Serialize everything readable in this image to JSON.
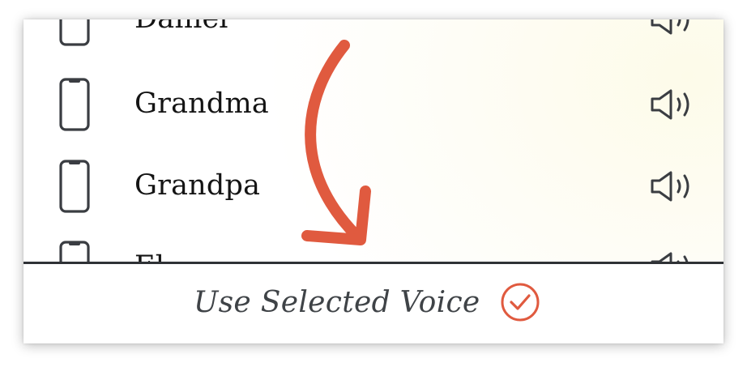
{
  "voices": [
    {
      "name": "Daniel"
    },
    {
      "name": "Grandma"
    },
    {
      "name": "Grandpa"
    },
    {
      "name": "El..."
    }
  ],
  "footer": {
    "use_voice_label": "Use Selected Voice"
  },
  "icons": {
    "device": "phone-icon",
    "play": "speaker-icon",
    "confirm": "check-circle-icon",
    "overlay": "curved-arrow-icon"
  },
  "colors": {
    "accent": "#e05a3f",
    "text": "#141414",
    "icon": "#3a3d42",
    "footer_text": "#3f4347",
    "divider": "#2f3236"
  }
}
